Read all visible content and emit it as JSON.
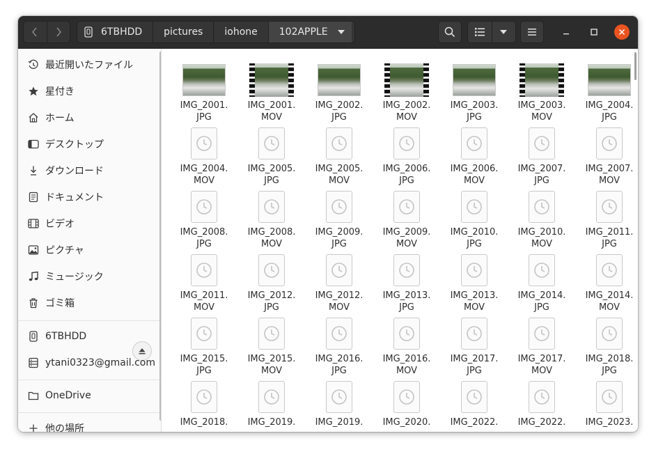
{
  "headerbar": {
    "path": [
      "6TBHDD",
      "pictures",
      "iohone",
      "102APPLE"
    ],
    "icons": {
      "back": "chevron-left-icon",
      "forward": "chevron-right-icon",
      "drive": "drive-icon",
      "dropdown": "chevron-down-icon",
      "search": "search-icon",
      "list_view": "list-view-icon",
      "view_options": "chevron-down-icon",
      "menu": "hamburger-menu-icon",
      "minimize": "minimize-icon",
      "maximize": "maximize-icon",
      "close": "close-icon"
    },
    "close_color": "#e95420"
  },
  "sidebar": {
    "places": [
      {
        "label": "最近開いたファイル",
        "icon": "recent-icon"
      },
      {
        "label": "星付き",
        "icon": "star-icon"
      },
      {
        "label": "ホーム",
        "icon": "home-icon"
      },
      {
        "label": "デスクトップ",
        "icon": "desktop-icon"
      },
      {
        "label": "ダウンロード",
        "icon": "download-icon"
      },
      {
        "label": "ドキュメント",
        "icon": "document-icon"
      },
      {
        "label": "ビデオ",
        "icon": "video-icon"
      },
      {
        "label": "ピクチャ",
        "icon": "picture-icon"
      },
      {
        "label": "ミュージック",
        "icon": "music-icon"
      },
      {
        "label": "ゴミ箱",
        "icon": "trash-icon"
      }
    ],
    "devices": [
      {
        "label": "6TBHDD",
        "icon": "drive-icon",
        "eject": true
      },
      {
        "label": "ytani0323@gmail.com",
        "icon": "network-server-icon"
      }
    ],
    "cloud": [
      {
        "label": "OneDrive",
        "icon": "folder-icon"
      }
    ],
    "other": {
      "label": "他の場所",
      "icon": "plus-icon"
    }
  },
  "files": [
    {
      "name": "IMG_2001.",
      "ext": "JPG",
      "thumb": "photo"
    },
    {
      "name": "IMG_2001.",
      "ext": "MOV",
      "thumb": "video"
    },
    {
      "name": "IMG_2002.",
      "ext": "JPG",
      "thumb": "photo"
    },
    {
      "name": "IMG_2002.",
      "ext": "MOV",
      "thumb": "video"
    },
    {
      "name": "IMG_2003.",
      "ext": "JPG",
      "thumb": "photo"
    },
    {
      "name": "IMG_2003.",
      "ext": "MOV",
      "thumb": "video"
    },
    {
      "name": "IMG_2004.",
      "ext": "JPG",
      "thumb": "photo"
    },
    {
      "name": "IMG_2004.",
      "ext": "MOV",
      "thumb": "loading"
    },
    {
      "name": "IMG_2005.",
      "ext": "JPG",
      "thumb": "loading"
    },
    {
      "name": "IMG_2005.",
      "ext": "MOV",
      "thumb": "loading"
    },
    {
      "name": "IMG_2006.",
      "ext": "JPG",
      "thumb": "loading"
    },
    {
      "name": "IMG_2006.",
      "ext": "MOV",
      "thumb": "loading"
    },
    {
      "name": "IMG_2007.",
      "ext": "JPG",
      "thumb": "loading"
    },
    {
      "name": "IMG_2007.",
      "ext": "MOV",
      "thumb": "loading"
    },
    {
      "name": "IMG_2008.",
      "ext": "JPG",
      "thumb": "loading"
    },
    {
      "name": "IMG_2008.",
      "ext": "MOV",
      "thumb": "loading"
    },
    {
      "name": "IMG_2009.",
      "ext": "JPG",
      "thumb": "loading"
    },
    {
      "name": "IMG_2009.",
      "ext": "MOV",
      "thumb": "loading"
    },
    {
      "name": "IMG_2010.",
      "ext": "JPG",
      "thumb": "loading"
    },
    {
      "name": "IMG_2010.",
      "ext": "MOV",
      "thumb": "loading"
    },
    {
      "name": "IMG_2011.",
      "ext": "JPG",
      "thumb": "loading"
    },
    {
      "name": "IMG_2011.",
      "ext": "MOV",
      "thumb": "loading"
    },
    {
      "name": "IMG_2012.",
      "ext": "JPG",
      "thumb": "loading"
    },
    {
      "name": "IMG_2012.",
      "ext": "MOV",
      "thumb": "loading"
    },
    {
      "name": "IMG_2013.",
      "ext": "JPG",
      "thumb": "loading"
    },
    {
      "name": "IMG_2013.",
      "ext": "MOV",
      "thumb": "loading"
    },
    {
      "name": "IMG_2014.",
      "ext": "JPG",
      "thumb": "loading"
    },
    {
      "name": "IMG_2014.",
      "ext": "MOV",
      "thumb": "loading"
    },
    {
      "name": "IMG_2015.",
      "ext": "JPG",
      "thumb": "loading"
    },
    {
      "name": "IMG_2015.",
      "ext": "MOV",
      "thumb": "loading"
    },
    {
      "name": "IMG_2016.",
      "ext": "JPG",
      "thumb": "loading"
    },
    {
      "name": "IMG_2016.",
      "ext": "MOV",
      "thumb": "loading"
    },
    {
      "name": "IMG_2017.",
      "ext": "JPG",
      "thumb": "loading"
    },
    {
      "name": "IMG_2017.",
      "ext": "MOV",
      "thumb": "loading"
    },
    {
      "name": "IMG_2018.",
      "ext": "JPG",
      "thumb": "loading"
    },
    {
      "name": "IMG_2018.",
      "ext": "",
      "thumb": "loading"
    },
    {
      "name": "IMG_2019.",
      "ext": "",
      "thumb": "loading"
    },
    {
      "name": "IMG_2019.",
      "ext": "",
      "thumb": "loading"
    },
    {
      "name": "IMG_2020.",
      "ext": "",
      "thumb": "loading"
    },
    {
      "name": "IMG_2022.",
      "ext": "",
      "thumb": "loading"
    },
    {
      "name": "IMG_2022.",
      "ext": "",
      "thumb": "loading"
    },
    {
      "name": "IMG_2023.",
      "ext": "",
      "thumb": "loading"
    }
  ]
}
